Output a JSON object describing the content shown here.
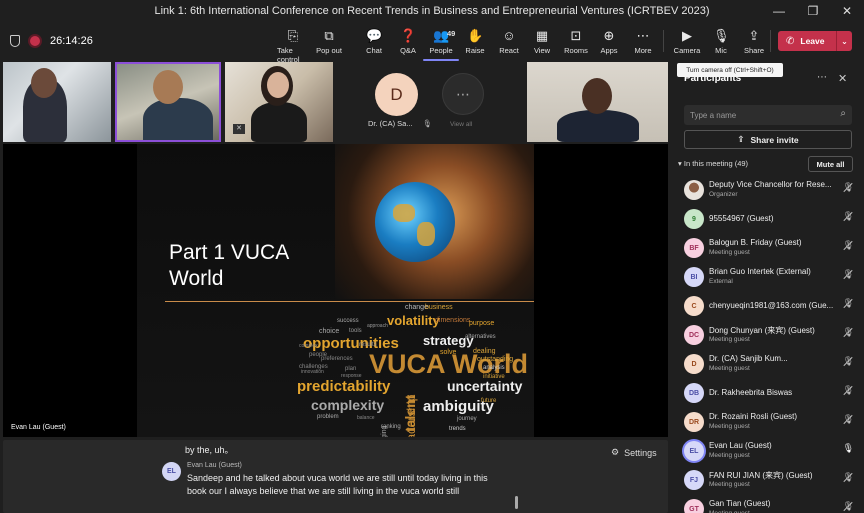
{
  "window": {
    "title": "Link 1: 6th International Conference on Recent Trends in Business and Entrepreneurial Ventures (ICRTBEV 2023)",
    "controls": [
      "—",
      "❐",
      "✕"
    ]
  },
  "toolbar": {
    "timer": "26:14:26",
    "buttons": [
      {
        "label": "Take control",
        "icon": "take-control-icon",
        "glyph": "⎘"
      },
      {
        "label": "Pop out",
        "icon": "pop-out-icon",
        "glyph": "⧉"
      },
      {
        "label": "Chat",
        "icon": "chat-icon",
        "glyph": "💬"
      },
      {
        "label": "Q&A",
        "icon": "qa-icon",
        "glyph": "❓"
      },
      {
        "label": "People",
        "icon": "people-icon",
        "glyph": "👥",
        "badge": "49"
      },
      {
        "label": "Raise",
        "icon": "raise-hand-icon",
        "glyph": "✋"
      },
      {
        "label": "React",
        "icon": "react-icon",
        "glyph": "☺"
      },
      {
        "label": "View",
        "icon": "view-icon",
        "glyph": "▦"
      },
      {
        "label": "Rooms",
        "icon": "rooms-icon",
        "glyph": "⊡"
      },
      {
        "label": "Apps",
        "icon": "apps-icon",
        "glyph": "⊕"
      },
      {
        "label": "More",
        "icon": "more-icon",
        "glyph": "⋯"
      },
      {
        "label": "Camera",
        "icon": "camera-icon",
        "glyph": "▶"
      },
      {
        "label": "Mic",
        "icon": "mic-icon",
        "glyph": "🎙"
      },
      {
        "label": "Share",
        "icon": "share-icon",
        "glyph": "⇪"
      }
    ],
    "leave_label": "Leave"
  },
  "video_strip": {
    "tile_d_initial": "D",
    "tile_d_name": "Dr. (CA) Sa...",
    "view_all_label": "View all"
  },
  "slide": {
    "title_line1": "Part 1 VUCA",
    "title_line2": "World",
    "word_cloud": [
      "change",
      "business",
      "volatility",
      "dimensions",
      "purpose",
      "success",
      "choice",
      "opportunities",
      "strategy",
      "alternatives",
      "VUCA World",
      "solve",
      "dealing",
      "outstanding",
      "analysis",
      "predictability",
      "uncertainty",
      "initiative",
      "complexity",
      "talent",
      "ambiguity",
      "future",
      "problem",
      "leadership",
      "journey",
      "trends",
      "changing",
      "ranking",
      "people",
      "plan",
      "challenges",
      "preferences",
      "results",
      "tools",
      "innovation",
      "response",
      "approach",
      "complex",
      "balance"
    ]
  },
  "stage": {
    "presenter_name": "Evan Lau (Guest)"
  },
  "captions": {
    "previous_line": "by the, uh。",
    "settings_label": "Settings",
    "speaker_initials": "EL",
    "speaker_name": "Evan Lau (Guest)",
    "text": "Sandeep and he talked about vuca world we are still until today living in this book our I always believe that we are still living in the vuca world still"
  },
  "panel": {
    "tooltip": "Turn camera off (Ctrl+Shift+O)",
    "title": "Participants",
    "search_placeholder": "Type a name",
    "share_invite_label": "Share invite",
    "in_meeting_label": "In this meeting (49)",
    "mute_all_label": "Mute all",
    "participants": [
      {
        "initials": "",
        "name": "Deputy Vice Chancellor for Rese...",
        "role": "Organizer",
        "color": "#7b6a5e",
        "text": "#ffffff",
        "mic": "muted",
        "photo": true
      },
      {
        "initials": "9",
        "name": "95554967 (Guest)",
        "role": "",
        "color": "#c8e6c9",
        "text": "#2e7d32",
        "mic": "muted"
      },
      {
        "initials": "BF",
        "name": "Balogun B. Friday (Guest)",
        "role": "Meeting guest",
        "color": "#f8d0e0",
        "text": "#a0305a",
        "mic": "muted"
      },
      {
        "initials": "BI",
        "name": "Brian Guo Intertek (External)",
        "role": "External",
        "color": "#d6d8f8",
        "text": "#4b4fa6",
        "mic": "muted"
      },
      {
        "initials": "C",
        "name": "chenyueqin1981@163.com (Gue...",
        "role": "",
        "color": "#f6dccb",
        "text": "#9a4a1e",
        "mic": "muted"
      },
      {
        "initials": "DC",
        "name": "Dong Chunyan (来宾) (Guest)",
        "role": "Meeting guest",
        "color": "#f8d0e0",
        "text": "#a0305a",
        "mic": "muted"
      },
      {
        "initials": "D",
        "name": "Dr. (CA) Sanjib Kum...",
        "role": "Meeting guest",
        "color": "#f6dccb",
        "text": "#9a4a1e",
        "mic": "muted"
      },
      {
        "initials": "DB",
        "name": "Dr. Rakheebrita Biswas",
        "role": "",
        "color": "#d6d8f8",
        "text": "#4b4fa6",
        "mic": "muted"
      },
      {
        "initials": "DR",
        "name": "Dr. Rozaini Rosli (Guest)",
        "role": "Meeting guest",
        "color": "#f6dccb",
        "text": "#9a4a1e",
        "mic": "muted"
      },
      {
        "initials": "EL",
        "name": "Evan Lau (Guest)",
        "role": "Meeting guest",
        "color": "#d6d8f8",
        "text": "#4b4fa6",
        "mic": "on",
        "speaking": true
      },
      {
        "initials": "FJ",
        "name": "FAN RUI JIAN (来宾) (Guest)",
        "role": "Meeting guest",
        "color": "#d6d8f8",
        "text": "#4b4fa6",
        "mic": "muted"
      },
      {
        "initials": "GT",
        "name": "Gan Tian (Guest)",
        "role": "Meeting guest",
        "color": "#f8d0e0",
        "text": "#a0305a",
        "mic": "muted"
      }
    ]
  }
}
